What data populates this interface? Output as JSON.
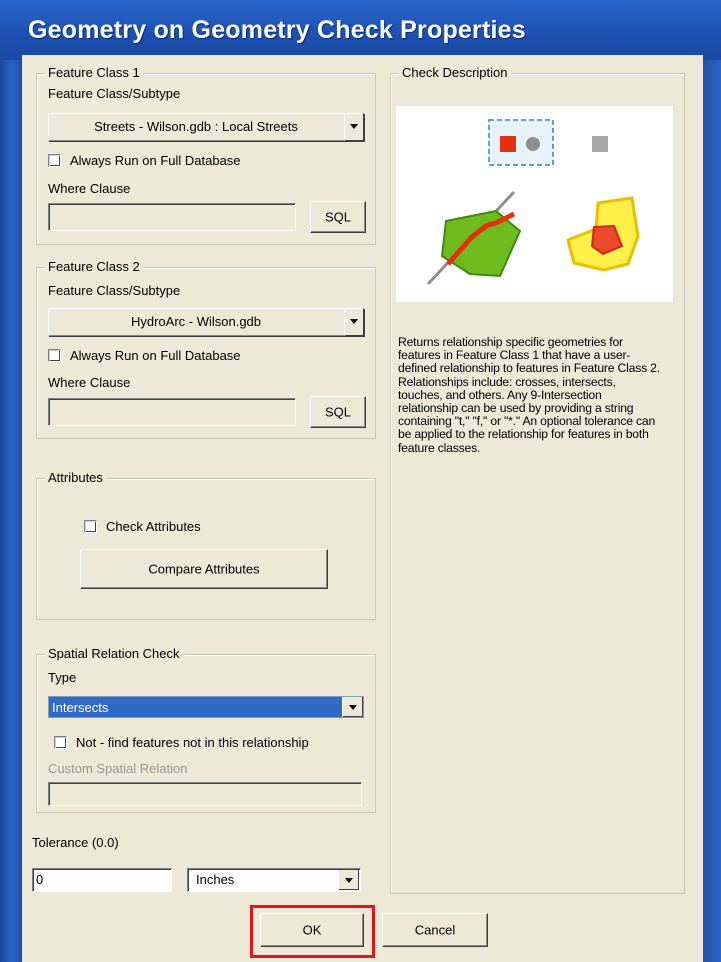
{
  "title": "Geometry on Geometry Check Properties",
  "feature_class_1": {
    "legend": "Feature Class 1",
    "subtype_label": "Feature Class/Subtype",
    "subtype_value": "Streets - Wilson.gdb : Local Streets",
    "always_run_label": "Always Run on Full Database",
    "where_label": "Where Clause",
    "where_value": "",
    "sql_label": "SQL"
  },
  "feature_class_2": {
    "legend": "Feature Class 2",
    "subtype_label": "Feature Class/Subtype",
    "subtype_value": "HydroArc - Wilson.gdb",
    "always_run_label": "Always Run on Full Database",
    "where_label": "Where Clause",
    "where_value": "",
    "sql_label": "SQL"
  },
  "attributes": {
    "legend": "Attributes",
    "check_label": "Check Attributes",
    "compare_label": "Compare Attributes"
  },
  "spatial": {
    "legend": "Spatial Relation Check",
    "type_label": "Type",
    "type_value": "Intersects",
    "not_label": "Not - find features not in this relationship",
    "custom_label": "Custom Spatial Relation",
    "custom_value": ""
  },
  "tolerance": {
    "label": "Tolerance (0.0)",
    "value": "0",
    "units": "Inches"
  },
  "check_description": {
    "legend": "Check Description",
    "text": "Returns relationship specific geometries for features in Feature Class 1 that have a user-defined relationship to features in Feature Class 2.  Relationships include: crosses, intersects, touches, and others.  Any 9-Intersection relationship can be used by providing a string containing \"t,\" \"f,\" or \"*.\"  An optional tolerance can be applied to the relationship for features in both feature classes."
  },
  "buttons": {
    "ok": "OK",
    "cancel": "Cancel"
  },
  "colors": {
    "highlight": "#e4141b",
    "selection": "#316ac5",
    "dialog": "#ece9d8"
  }
}
